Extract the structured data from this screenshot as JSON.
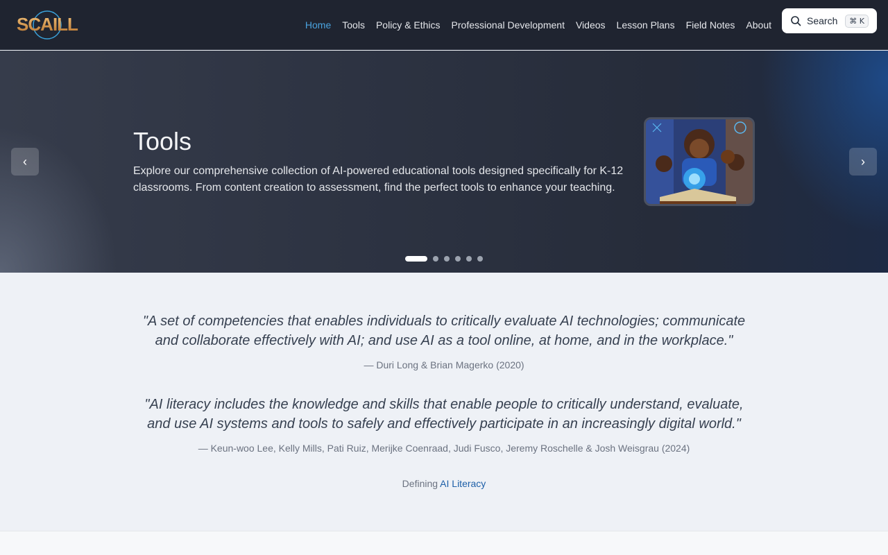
{
  "brand": {
    "name": "SCAILL"
  },
  "nav": {
    "items": [
      {
        "label": "Home",
        "active": true
      },
      {
        "label": "Tools"
      },
      {
        "label": "Policy & Ethics"
      },
      {
        "label": "Professional Development"
      },
      {
        "label": "Videos"
      },
      {
        "label": "Lesson Plans"
      },
      {
        "label": "Field Notes"
      },
      {
        "label": "About"
      }
    ]
  },
  "search": {
    "label": "Search",
    "shortcut": "⌘ K"
  },
  "hero": {
    "title": "Tools",
    "description": "Explore our comprehensive collection of AI-powered educational tools designed specifically for K-12 classrooms. From content creation to assessment, find the perfect tools to enhance your teaching.",
    "slide_count": 6,
    "active_slide": 1
  },
  "quotes": [
    {
      "text": "\"A set of competencies that enables individuals to critically evaluate AI technologies; communicate and collaborate effectively with AI; and use AI as a tool online, at home, and in the workplace.\"",
      "citation": "— Duri Long & Brian Magerko (2020)"
    },
    {
      "text": "\"AI literacy includes the knowledge and skills that enable people to critically understand, evaluate, and use AI systems and tools to safely and effectively participate in an increasingly digital world.\"",
      "citation": "— Keun-woo Lee, Kelly Mills, Pati Ruiz, Merijke Coenraad, Judi Fusco, Jeremy Roschelle & Josh Weisgrau (2024)"
    }
  ],
  "defining": {
    "prefix": "Defining",
    "link": "AI Literacy"
  },
  "colors": {
    "accent": "#4aa3df",
    "header_bg": "#1f2430",
    "link": "#1d5fa8"
  }
}
